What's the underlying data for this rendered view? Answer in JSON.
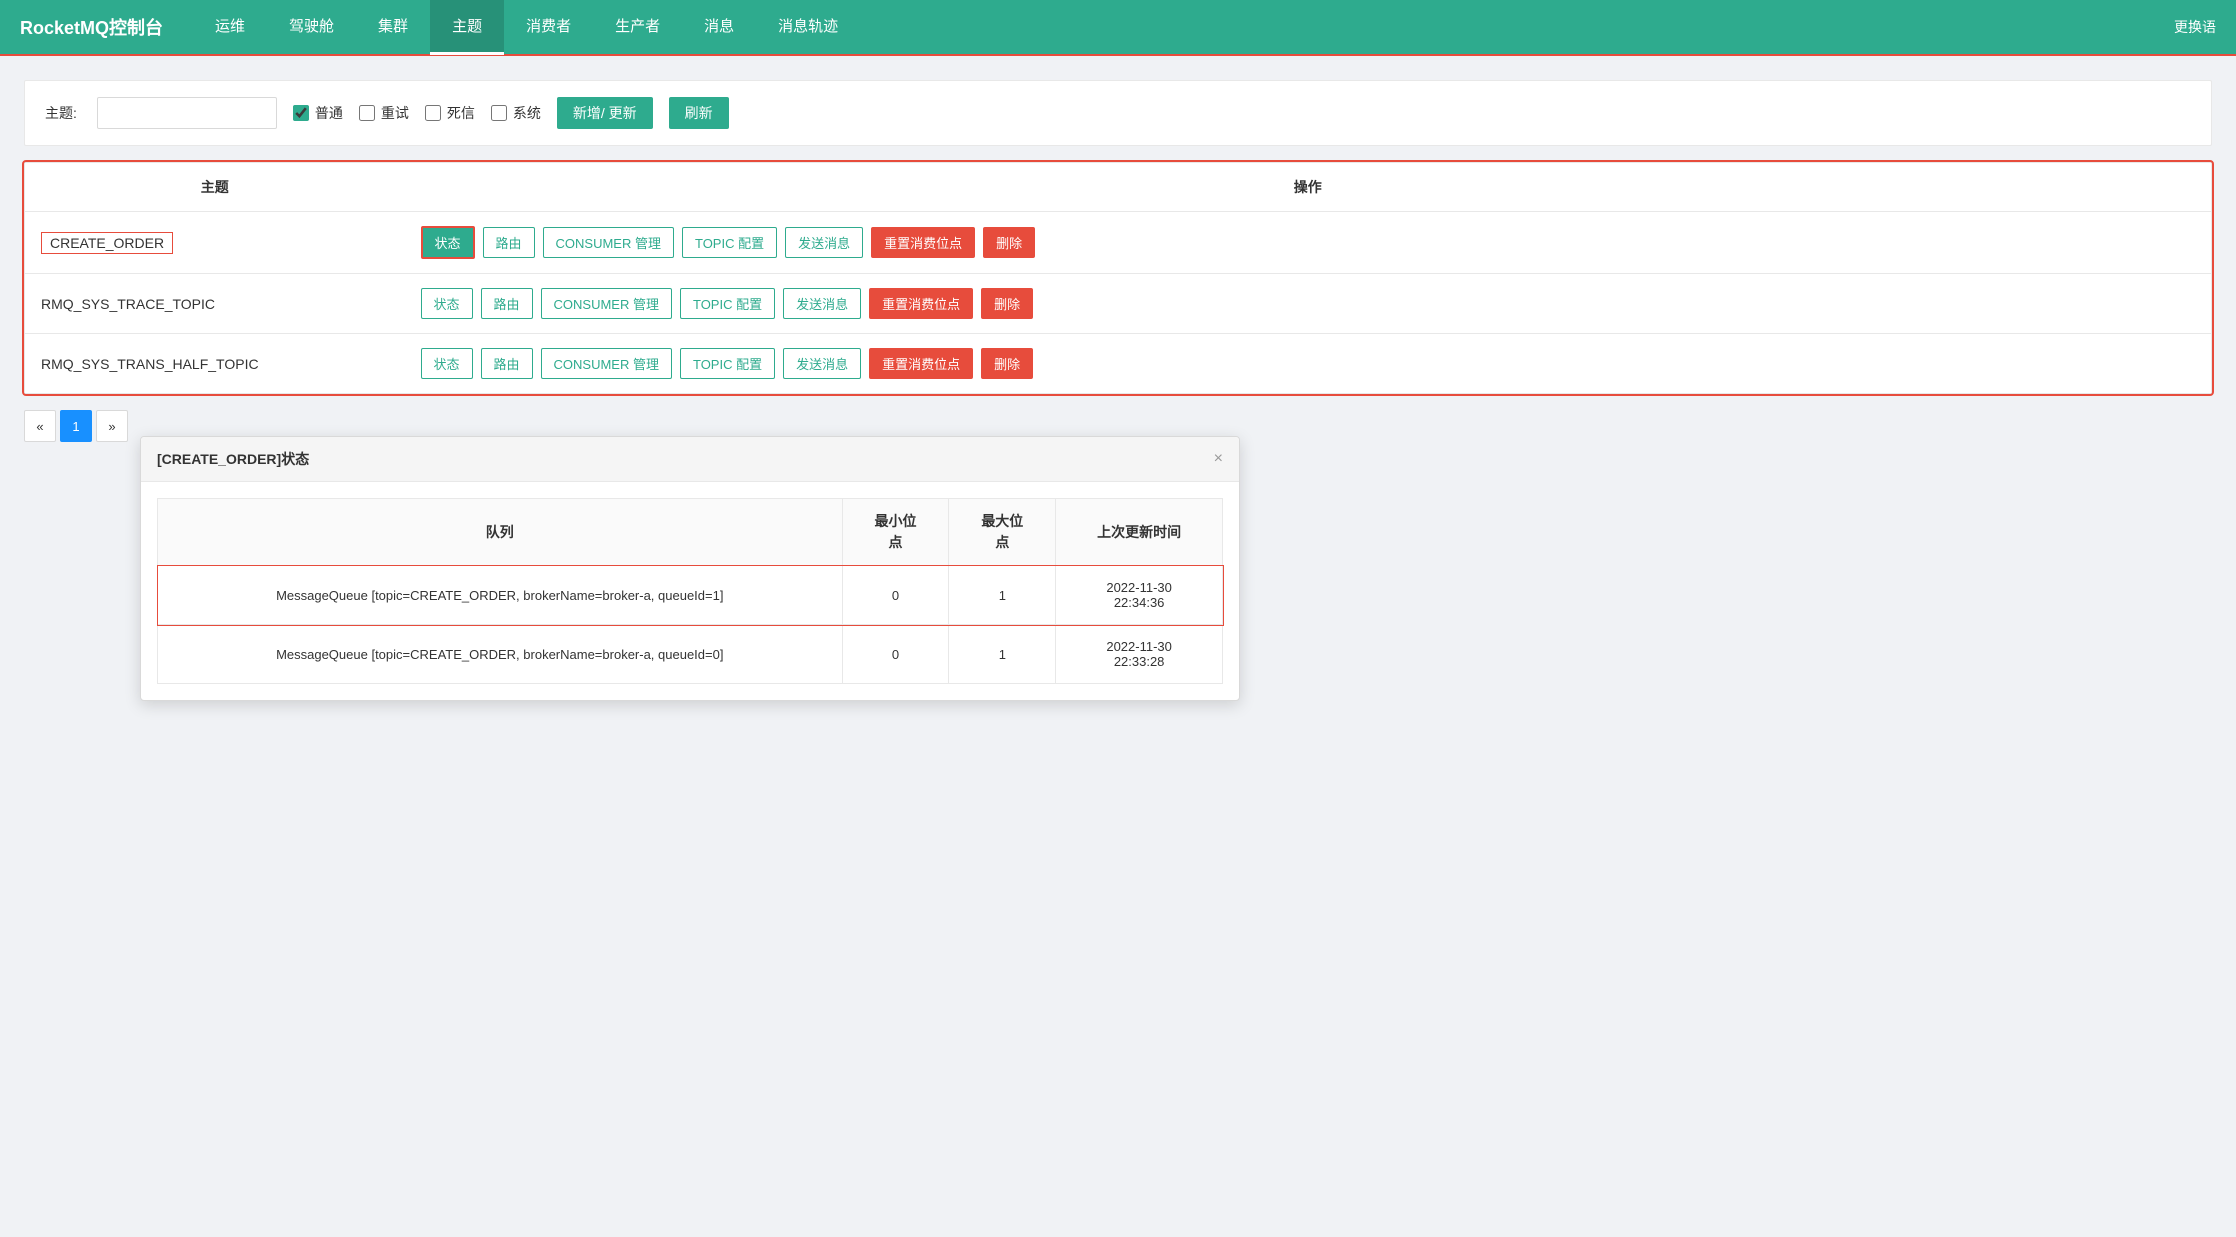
{
  "navbar": {
    "brand": "RocketMQ控制台",
    "items": [
      {
        "label": "运维",
        "key": "ops"
      },
      {
        "label": "驾驶舱",
        "key": "dashboard"
      },
      {
        "label": "集群",
        "key": "cluster"
      },
      {
        "label": "主题",
        "key": "topic",
        "active": true
      },
      {
        "label": "消费者",
        "key": "consumer"
      },
      {
        "label": "生产者",
        "key": "producer"
      },
      {
        "label": "消息",
        "key": "message"
      },
      {
        "label": "消息轨迹",
        "key": "trace"
      }
    ],
    "right_label": "更换语"
  },
  "filter": {
    "label": "主题:",
    "input_placeholder": "",
    "checkboxes": [
      {
        "label": "普通",
        "checked": true,
        "teal": true
      },
      {
        "label": "重试",
        "checked": false
      },
      {
        "label": "死信",
        "checked": false
      },
      {
        "label": "系统",
        "checked": false
      }
    ],
    "btn_add": "新增/ 更新",
    "btn_refresh": "刷新"
  },
  "table": {
    "col_topic": "主题",
    "col_action": "操作",
    "rows": [
      {
        "topic": "CREATE_ORDER",
        "highlighted": true,
        "buttons": [
          "状态",
          "路由",
          "CONSUMER 管理",
          "TOPIC 配置",
          "发送消息",
          "重置消费位点",
          "删除"
        ]
      },
      {
        "topic": "RMQ_SYS_TRACE_TOPIC",
        "highlighted": false,
        "buttons": [
          "状态",
          "路由",
          "CONSUMER 管理",
          "TOPIC 配置",
          "发送消息",
          "重置消费位点",
          "删除"
        ]
      },
      {
        "topic": "RMQ_SYS_TRANS_HALF_TOPIC",
        "highlighted": false,
        "buttons": [
          "状态",
          "路由",
          "CONSUMER 管理",
          "TOPIC 配置",
          "发送消息",
          "重置消费位点",
          "删除"
        ]
      }
    ]
  },
  "pagination": {
    "prev": "«",
    "page": "1",
    "next": "»"
  },
  "modal": {
    "title": "[CREATE_ORDER]状态",
    "close": "×",
    "col_queue": "队列",
    "col_min_offset": "最小位\n点",
    "col_max_offset": "最大位\n点",
    "col_last_update": "上次更新时间",
    "rows": [
      {
        "queue": "MessageQueue [topic=CREATE_ORDER, brokerName=broker-a, queueId=1]",
        "min_offset": "0",
        "max_offset": "1",
        "last_update": "2022-11-30\n22:34:36",
        "highlighted": true
      },
      {
        "queue": "MessageQueue [topic=CREATE_ORDER, brokerName=broker-a, queueId=0]",
        "min_offset": "0",
        "max_offset": "1",
        "last_update": "2022-11-30\n22:33:28",
        "highlighted": false
      }
    ]
  }
}
